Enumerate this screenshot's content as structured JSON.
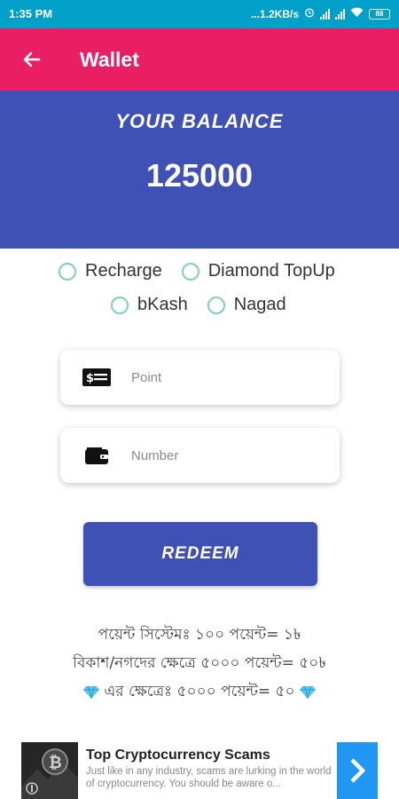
{
  "status_bar": {
    "time": "1:35 PM",
    "network_speed": "...1.2KB/s",
    "battery": "88"
  },
  "app_bar": {
    "title": "Wallet"
  },
  "balance": {
    "label": "YOUR BALANCE",
    "value": "125000"
  },
  "options": [
    {
      "label": "Recharge"
    },
    {
      "label": "Diamond TopUp"
    },
    {
      "label": "bKash"
    },
    {
      "label": "Nagad"
    }
  ],
  "fields": {
    "point_placeholder": "Point",
    "number_placeholder": "Number"
  },
  "redeem_label": "REDEEM",
  "info": {
    "line1": "পয়েন্ট সিস্টেমঃ ১০০ পয়েন্ট= ১৳",
    "line2": "বিকাশ/নগদের ক্ষেত্রে ৫০০০ পয়েন্ট= ৫০৳",
    "line3": "এর ক্ষেত্রেঃ ৫০০০ পয়েন্ট= ৫০"
  },
  "ad": {
    "title": "Top Cryptocurrency Scams",
    "description": "Just like in any industry, scams are lurking in the world of cryptocurrency. You should be aware o..."
  },
  "colors": {
    "status_bar": "#00a0c9",
    "app_bar": "#e91e63",
    "primary": "#3f51b5",
    "radio": "#7fcfc0",
    "ad_arrow": "#2196f3"
  },
  "icons": {
    "back": "arrow-left-icon",
    "point_field": "money-card-icon",
    "number_field": "wallet-icon",
    "info_line3": "diamond-icon",
    "ad_arrow": "chevron-right-icon"
  }
}
